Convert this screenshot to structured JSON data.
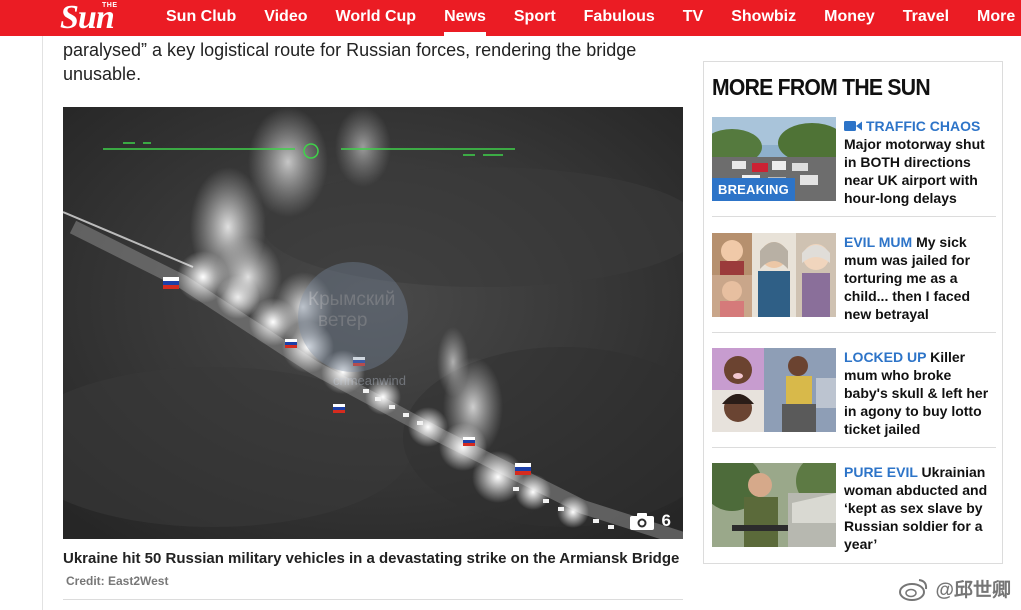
{
  "nav": {
    "logo_small": "THE",
    "logo_main": "Sun",
    "items": [
      "Sun Club",
      "Video",
      "World Cup",
      "News",
      "Sport",
      "Fabulous",
      "TV",
      "Showbiz",
      "Money",
      "Travel",
      "More"
    ],
    "active_index": 3
  },
  "article": {
    "lead_text": "paralysed” a key logistical route for Russian forces, rendering the bridge unusable.",
    "gallery_count": "6",
    "caption": "Ukraine hit 50 Russian military vehicles in a devastating strike on the Armiansk Bridge",
    "credit": "Credit: East2West",
    "photo_watermark_1": "Крымский",
    "photo_watermark_2": "ветер",
    "photo_watermark_3": "crimeanwind"
  },
  "sidebar": {
    "title": "MORE FROM THE SUN",
    "stories": [
      {
        "kicker": "TRAFFIC CHAOS",
        "headline": "Major motorway shut in BOTH directions near UK airport with hour-long delays",
        "badge": "BREAKING",
        "has_video": true
      },
      {
        "kicker": "EVIL MUM",
        "headline": "My sick mum was jailed for torturing me as a child... then I faced new betrayal",
        "badge": "",
        "has_video": false
      },
      {
        "kicker": "LOCKED UP",
        "headline": "Killer mum who broke baby's skull & left her in agony to buy lotto ticket jailed",
        "badge": "",
        "has_video": false
      },
      {
        "kicker": "PURE EVIL",
        "headline": "Ukrainian woman abducted and ‘kept as sex slave by Russian soldier for a year’",
        "badge": "",
        "has_video": false
      }
    ]
  },
  "watermark": {
    "text": "@邱世卿"
  },
  "colors": {
    "brand_red": "#eb1c24",
    "kicker_blue": "#2d74c8"
  }
}
